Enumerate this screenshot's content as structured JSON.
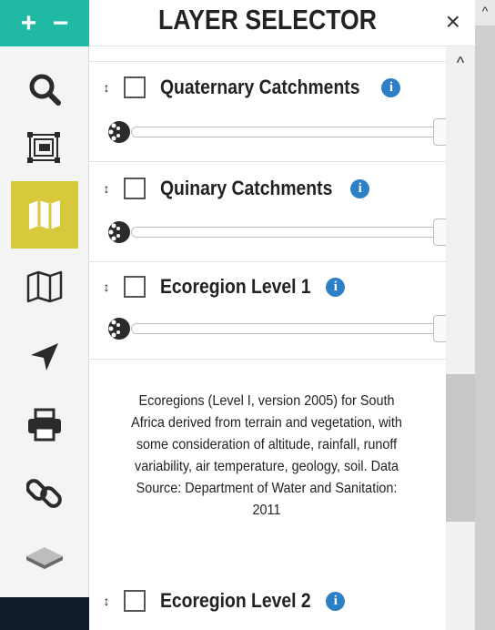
{
  "toolbar": {
    "zoom_in_label": "+",
    "zoom_out_label": "−",
    "tools": [
      {
        "icon": "search-icon",
        "active": false
      },
      {
        "icon": "extent-icon",
        "active": false
      },
      {
        "icon": "layers-map-icon",
        "active": true
      },
      {
        "icon": "map-icon",
        "active": false
      },
      {
        "icon": "locate-arrow-icon",
        "active": false
      },
      {
        "icon": "print-icon",
        "active": false
      },
      {
        "icon": "link-icon",
        "active": false
      },
      {
        "icon": "basemap-icon",
        "active": false
      }
    ],
    "active_color": "#d8c93c",
    "zoom_bar_color": "#1fb9a4"
  },
  "header": {
    "title": "LAYER SELECTOR",
    "close_label": "×"
  },
  "layers": [
    {
      "name": "Quaternary Catchments",
      "checked": false,
      "has_slider": true
    },
    {
      "name": "Quinary Catchments",
      "checked": false,
      "has_slider": true
    },
    {
      "name": "Ecoregion Level 1",
      "checked": false,
      "has_slider": true
    },
    {
      "name": "Ecoregion Level 2",
      "checked": false,
      "has_slider": false
    }
  ],
  "description": "Ecoregions (Level I, version 2005) for South Africa derived from terrain and vegetation, with some consideration of altitude, rainfall, runoff variability, air temperature, geology, soil. Data Source: Department of Water and Sanitation: 2011",
  "info_label": "i",
  "drag_label": "↕",
  "scroll_up_label": "^",
  "info_color": "#2d7fc6"
}
